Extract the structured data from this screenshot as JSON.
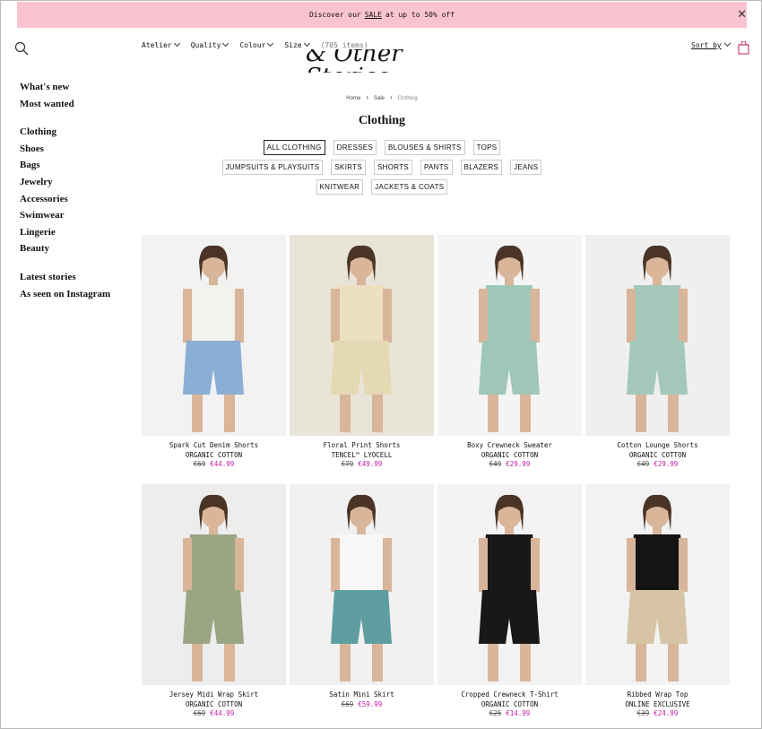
{
  "promo": {
    "before": "Discover our",
    "sale": "SALE",
    "after": "at up to 50% off"
  },
  "toolbar": {
    "filters": [
      "Atelier",
      "Quality",
      "Colour",
      "Size"
    ],
    "count": "(705 items)",
    "sort": "Sort by"
  },
  "logo": "& Other Stories",
  "sidebar": {
    "groups": [
      [
        "What's new",
        "Most wanted"
      ],
      [
        "Clothing",
        "Shoes",
        "Bags",
        "Jewelry",
        "Accessories",
        "Swimwear",
        "Lingerie",
        "Beauty"
      ],
      [
        "Latest stories",
        "As seen on Instagram"
      ]
    ]
  },
  "breadcrumb": [
    "Home",
    "Sale",
    "Clothing"
  ],
  "page_title": "Clothing",
  "categories": [
    [
      "ALL CLOTHING",
      "DRESSES",
      "BLOUSES & SHIRTS",
      "TOPS"
    ],
    [
      "JUMPSUITS & PLAYSUITS",
      "SKIRTS",
      "SHORTS",
      "PANTS",
      "BLAZERS",
      "JEANS"
    ],
    [
      "KNITWEAR",
      "JACKETS & COATS"
    ]
  ],
  "products": [
    {
      "name": "Spark Cut Denim Shorts",
      "material": "ORGANIC COTTON",
      "old_price": "€69",
      "price": "€44.99",
      "top": "#f4f2ec",
      "bottom": "#8aaed6",
      "bg": "#f2f2f2"
    },
    {
      "name": "Floral Print Shorts",
      "material": "TENCEL™ LYOCELL",
      "old_price": "€79",
      "price": "€49.99",
      "top": "#ebe1c0",
      "bottom": "#e4d9b2",
      "bg": "#e8e4d8"
    },
    {
      "name": "Boxy Crewneck Sweater",
      "material": "ORGANIC COTTON",
      "old_price": "€49",
      "price": "€29.99",
      "top": "#9fc7b7",
      "bottom": "#9fc7b7",
      "bg": "#f4f4f4"
    },
    {
      "name": "Cotton Lounge Shorts",
      "material": "ORGANIC COTTON",
      "old_price": "€49",
      "price": "€29.99",
      "top": "#a3c8ba",
      "bottom": "#a3c8ba",
      "bg": "#efefef"
    },
    {
      "name": "Jersey Midi Wrap Skirt",
      "material": "ORGANIC COTTON",
      "old_price": "€69",
      "price": "€44.99",
      "top": "#9aa584",
      "bottom": "#9aa584",
      "bg": "#ededed"
    },
    {
      "name": "Satin Mini Skirt",
      "material": "",
      "old_price": "€69",
      "price": "€59.99",
      "top": "#f7f7f5",
      "bottom": "#5f9ea0",
      "bg": "#f1f1f1"
    },
    {
      "name": "Cropped Crewneck T-Shirt",
      "material": "ORGANIC COTTON",
      "old_price": "€25",
      "price": "€14.99",
      "top": "#181818",
      "bottom": "#181818",
      "bg": "#f3f3f3"
    },
    {
      "name": "Ribbed Wrap Top",
      "material": "ONLINE EXCLUSIVE",
      "old_price": "€39",
      "price": "€24.99",
      "top": "#141414",
      "bottom": "#d6c4a4",
      "bg": "#f2f2f2"
    }
  ]
}
